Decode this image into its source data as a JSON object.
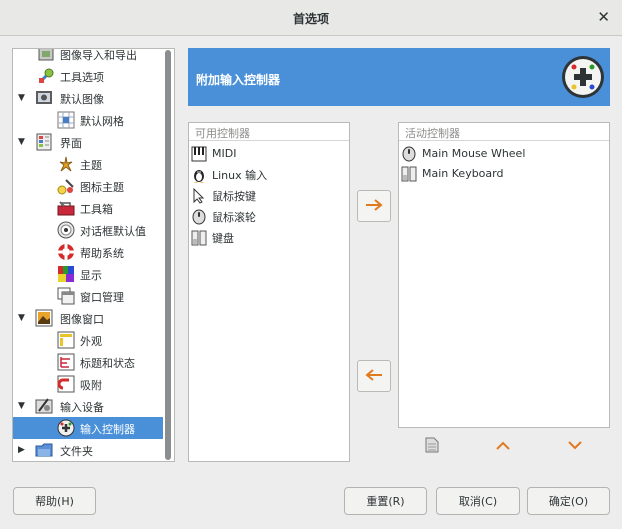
{
  "window": {
    "title": "首选项",
    "close_glyph": "✕"
  },
  "tree": {
    "items": [
      {
        "label": "图像导入和导出",
        "icon": "image-import-export-icon",
        "expander": ""
      },
      {
        "label": "工具选项",
        "icon": "tool-options-icon",
        "expander": ""
      },
      {
        "label": "默认图像",
        "icon": "default-image-icon",
        "expander": "▼"
      },
      {
        "label": "默认网格",
        "icon": "default-grid-icon",
        "expander": ""
      },
      {
        "label": "界面",
        "icon": "interface-icon",
        "expander": "▼"
      },
      {
        "label": "主题",
        "icon": "theme-icon",
        "expander": ""
      },
      {
        "label": "图标主题",
        "icon": "icon-theme-icon",
        "expander": ""
      },
      {
        "label": "工具箱",
        "icon": "toolbox-icon",
        "expander": ""
      },
      {
        "label": "对话框默认值",
        "icon": "dialog-defaults-icon",
        "expander": ""
      },
      {
        "label": "帮助系统",
        "icon": "help-system-icon",
        "expander": ""
      },
      {
        "label": "显示",
        "icon": "display-icon",
        "expander": ""
      },
      {
        "label": "窗口管理",
        "icon": "window-management-icon",
        "expander": ""
      },
      {
        "label": "图像窗口",
        "icon": "image-window-icon",
        "expander": "▼"
      },
      {
        "label": "外观",
        "icon": "appearance-icon",
        "expander": ""
      },
      {
        "label": "标题和状态",
        "icon": "title-status-icon",
        "expander": ""
      },
      {
        "label": "吸附",
        "icon": "snap-icon",
        "expander": ""
      },
      {
        "label": "输入设备",
        "icon": "input-devices-icon",
        "expander": "▼"
      },
      {
        "label": "输入控制器",
        "icon": "input-controllers-icon",
        "expander": ""
      },
      {
        "label": "文件夹",
        "icon": "folders-icon",
        "expander": "▶"
      }
    ]
  },
  "header": {
    "title": "附加输入控制器",
    "icon": "input-controller-gamepad-icon"
  },
  "available": {
    "heading": "可用控制器",
    "items": [
      {
        "label": "MIDI",
        "icon": "midi-keyboard-icon"
      },
      {
        "label": "Linux 输入",
        "icon": "linux-tux-icon"
      },
      {
        "label": "鼠标按键",
        "icon": "mouse-pointer-icon"
      },
      {
        "label": "鼠标滚轮",
        "icon": "mouse-wheel-icon"
      },
      {
        "label": "键盘",
        "icon": "keyboard-icon"
      }
    ]
  },
  "active": {
    "heading": "活动控制器",
    "items": [
      {
        "label": "Main Mouse Wheel",
        "icon": "mouse-wheel-icon"
      },
      {
        "label": "Main Keyboard",
        "icon": "keyboard-icon"
      }
    ]
  },
  "buttons": {
    "help": "帮助(H)",
    "reset": "重置(R)",
    "cancel": "取消(C)",
    "ok": "确定(O)"
  },
  "colors": {
    "accent": "#4a90d9",
    "arrow": "#e07a1f"
  }
}
